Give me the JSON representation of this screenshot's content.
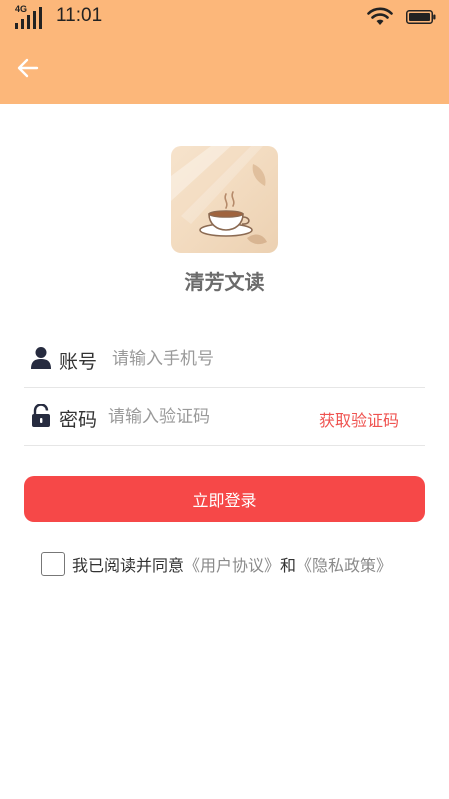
{
  "status_bar": {
    "network": "4G",
    "time": "11:01"
  },
  "header": {
    "background": "#fcb77a",
    "back_icon": "arrow-left-icon"
  },
  "app": {
    "name": "清芳文读",
    "logo_icon": "coffee-cup-icon"
  },
  "form": {
    "phone": {
      "icon": "user-icon",
      "label": "账号",
      "placeholder": "请输入手机号",
      "value": ""
    },
    "code": {
      "icon": "lock-icon",
      "label": "密码",
      "placeholder": "请输入验证码",
      "value": "",
      "get_code_label": "获取验证码"
    },
    "login_label": "立即登录"
  },
  "agreement": {
    "checked": false,
    "prefix": "我已阅读并同意",
    "user_agreement": "《用户协议》",
    "connector": "和",
    "privacy_policy": "《隐私政策》"
  },
  "colors": {
    "accent": "#f64848",
    "link": "#ef5350"
  }
}
